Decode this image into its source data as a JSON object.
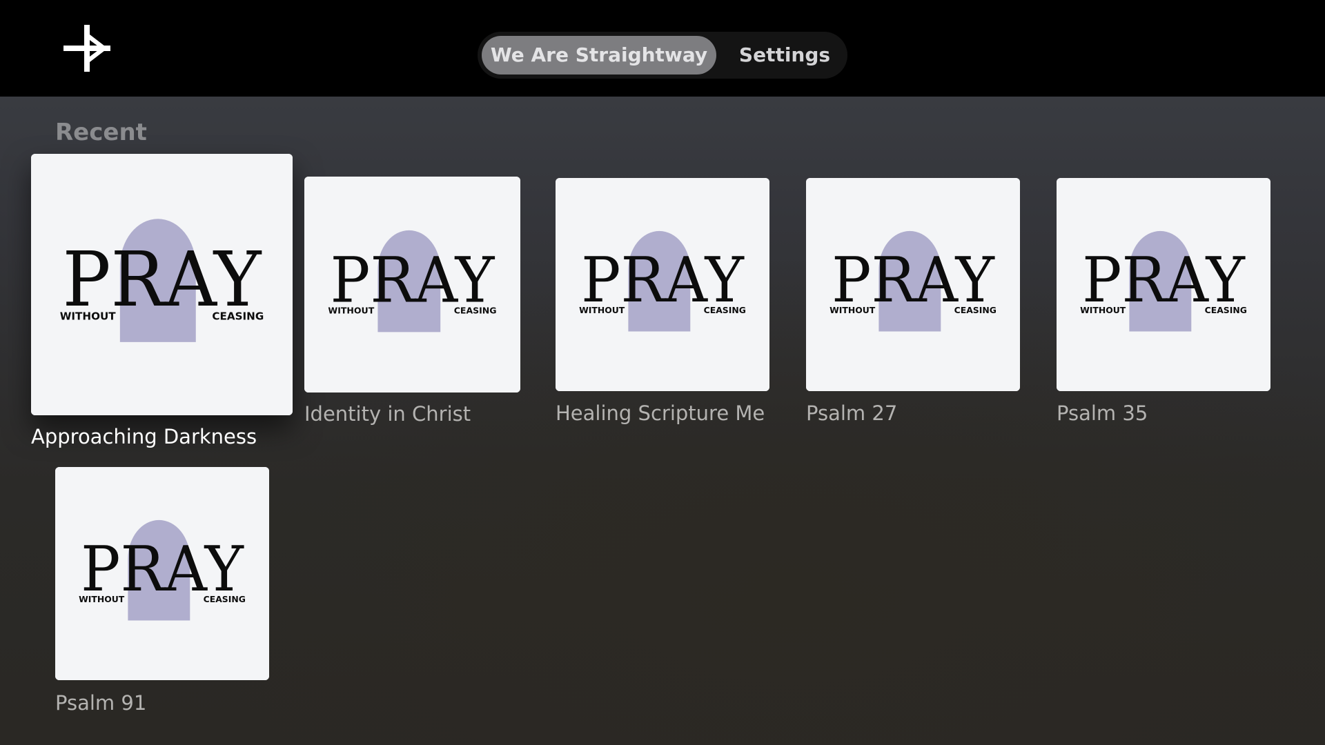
{
  "nav": {
    "tabs": [
      {
        "label": "We Are Straightway",
        "active": true
      },
      {
        "label": "Settings",
        "active": false
      }
    ]
  },
  "recent": {
    "title": "Recent",
    "items": [
      {
        "title": "Approaching Darkness",
        "focused": true
      },
      {
        "title": "Identity in Christ",
        "focused": false
      },
      {
        "title": "Healing Scripture Meditation",
        "focused": false
      },
      {
        "title": "Psalm 27",
        "focused": false
      },
      {
        "title": "Psalm 35",
        "focused": false
      },
      {
        "title": "Psalm 91",
        "focused": false
      }
    ]
  },
  "artwork": {
    "word": "PRAY",
    "left_caption": "WITHOUT",
    "right_caption": "CEASING"
  },
  "colors": {
    "topbar": "#000000",
    "active_tab": "#7d7d80",
    "art_background": "#f4f5f7",
    "art_arch": "#a9a6c9",
    "caption_muted": "#b4b3b1"
  },
  "icons": {
    "logo": "cross-arrow-logo-icon"
  }
}
